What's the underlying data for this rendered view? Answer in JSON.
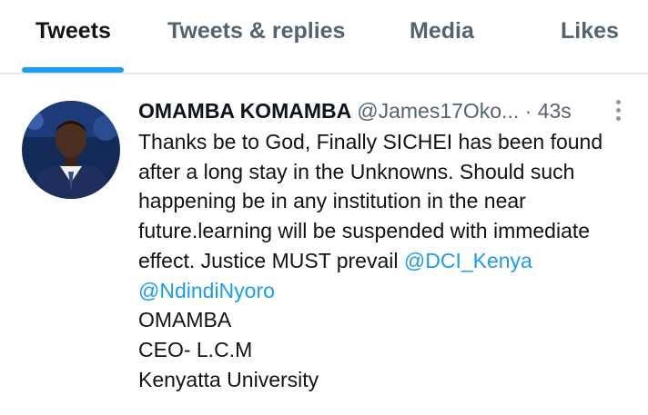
{
  "tabs": [
    {
      "label": "Tweets",
      "active": true
    },
    {
      "label": "Tweets & replies",
      "active": false
    },
    {
      "label": "Media",
      "active": false
    },
    {
      "label": "Likes",
      "active": false
    }
  ],
  "tweet": {
    "author_name": "OMAMBA KOMAMBA",
    "handle": "@James17Oko...",
    "time_separator": "·",
    "time": "43s",
    "more_icon": "vertical-ellipsis-icon",
    "text_line_1": "Thanks be to God, Finally SICHEI has been found",
    "text_line_2": "after a long stay in the Unknowns. Should such",
    "text_line_3": "happening be in any institution in the near",
    "text_line_4": "future.learning will be suspended with immediate",
    "text_line_5": "effect. Justice MUST prevail",
    "mention_1": "@DCI_Kenya",
    "mention_2": "@NdindiNyoro",
    "signature_1": "OMAMBA",
    "signature_2": "CEO- L.C.M",
    "signature_3": "Kenyatta University"
  },
  "colors": {
    "accent": "#1d9bf0",
    "text_primary": "#0f1419",
    "text_secondary": "#536471",
    "divider": "#e1e8ed"
  }
}
